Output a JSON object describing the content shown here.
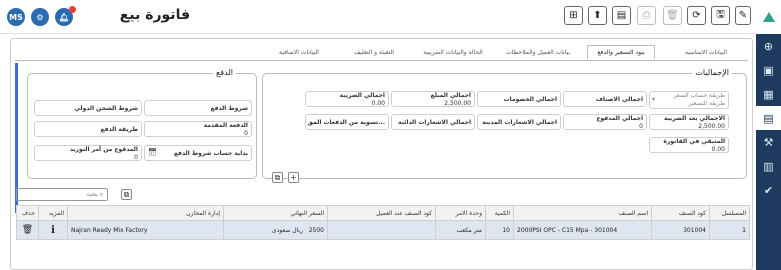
{
  "header": {
    "title": "فاتورة بيع",
    "avatar": "MS",
    "toolbar": {
      "edit": "✎",
      "save": "🖫",
      "refresh": "⟳",
      "delete": "🗑",
      "print": "⎙",
      "card": "▤",
      "export": "⬆",
      "new": "+"
    }
  },
  "tabs": [
    {
      "label": "البيانات الاساسية"
    },
    {
      "label": "بنود التسعير والدفع"
    },
    {
      "label": "بيانات العميل والملاحظات"
    },
    {
      "label": "الحالة والبيانات الضريبية"
    },
    {
      "label": "التعبئة و التغليف"
    },
    {
      "label": "البيانات الاضافية"
    }
  ],
  "totals": {
    "legend": "الإجماليات",
    "price_account": "طريقة حساب السعر",
    "price_method": "طريقة التسعير",
    "items_total_label": "اجمالي الاصناف",
    "discounts_total_label": "اجمالي الخصومات",
    "amount_total_label": "اجمالي المبلغ",
    "amount_total_value": "2,500.00",
    "tax_total_label": "اجمالي الضريبة",
    "tax_total_value": "0.00",
    "after_tax_label": "الاجمالي بعد الضريبة",
    "after_tax_value": "2,500.00",
    "paid_total_label": "اجمالي المدفوع",
    "paid_total_value": "0",
    "debit_notes_label": "اجمالي الاشعارات المدينة",
    "credit_notes_label": "اجمالي الاشعارات الدائنة",
    "settlement_label": "تسوية من الدفعات المق...",
    "remaining_label": "المتبقي في الفاتورة",
    "remaining_value": "0.00"
  },
  "payment": {
    "legend": "الدفع",
    "payment_terms_label": "شروط الدفع",
    "shipping_terms_label": "شروط الشحن الدولي",
    "advance_label": "الدفعة المقدمة",
    "advance_value": "0",
    "payment_method_label": "طريقة الدفع",
    "terms_start_label": "بداية حساب شروط الدفع",
    "paid_from_po_label": "المدفوع من أمر التوريد",
    "paid_from_po_value": "0"
  },
  "table": {
    "search_placeholder": "بحث",
    "columns": [
      "المسلسل",
      "كود الصنف",
      "اسم الصنف",
      "الكمية",
      "وحدة الامر",
      "كود الصنف عند العميل",
      "السعر النهائي",
      "إدارة المخازن",
      "المزيد",
      "حذف"
    ],
    "rows": [
      {
        "serial": "1",
        "item_code": "301004",
        "item_name": "2000PSI OPC - C15 Mpa - 301004",
        "quantity": "10",
        "unit": "متر مكعب",
        "customer_code": "",
        "final_price": "2500",
        "currency": "ريال سعودى",
        "warehouse": "Najran Ready Mix Factory"
      }
    ]
  }
}
